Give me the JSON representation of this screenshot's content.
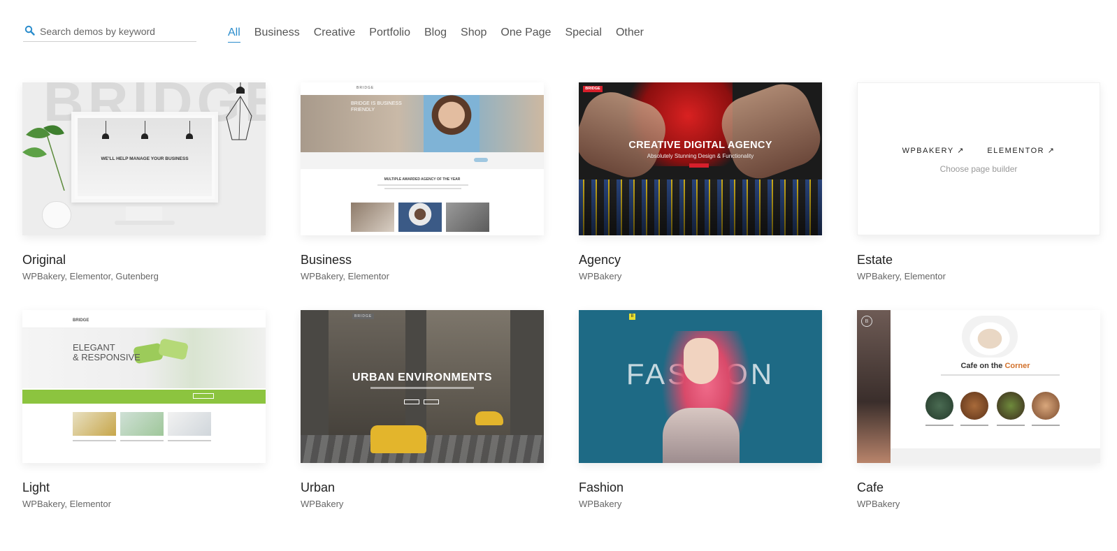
{
  "search": {
    "placeholder": "Search demos by keyword",
    "value": "",
    "icon": "search-icon"
  },
  "filters": [
    {
      "label": "All",
      "active": true
    },
    {
      "label": "Business",
      "active": false
    },
    {
      "label": "Creative",
      "active": false
    },
    {
      "label": "Portfolio",
      "active": false
    },
    {
      "label": "Blog",
      "active": false
    },
    {
      "label": "Shop",
      "active": false
    },
    {
      "label": "One Page",
      "active": false
    },
    {
      "label": "Special",
      "active": false
    },
    {
      "label": "Other",
      "active": false
    }
  ],
  "accent_color": "#2a8ccc",
  "demos": [
    {
      "title": "Original",
      "builders": "WPBakery,  Elementor,  Gutenberg",
      "preview": {
        "bg_word": "BRIDGE",
        "screen_text": "WE'LL HELP MANAGE YOUR BUSINESS"
      }
    },
    {
      "title": "Business",
      "builders": "WPBakery,  Elementor",
      "preview": {
        "logo": "BRIDGE",
        "hero_text": "BRIDGE IS BUSINESS FRIENDLY",
        "section_title": "MULTIPLE AWARDED AGENCY OF THE YEAR"
      }
    },
    {
      "title": "Agency",
      "builders": "WPBakery",
      "preview": {
        "badge": "BRIDGE",
        "headline": "CREATIVE DIGITAL AGENCY",
        "subline": "Absolutely Stunning Design & Functionality"
      }
    },
    {
      "title": "Estate",
      "builders": "WPBakery,  Elementor",
      "preview": {
        "link_wpbakery": "WPBAKERY ↗",
        "link_elementor": "ELEMENTOR ↗",
        "hint": "Choose page builder"
      }
    },
    {
      "title": "Light",
      "builders": "WPBakery,  Elementor",
      "preview": {
        "logo": "BRIDGE",
        "headline_1": "ELEGANT",
        "headline_2": "& RESPONSIVE"
      }
    },
    {
      "title": "Urban",
      "builders": "WPBakery",
      "preview": {
        "logo": "BRIDGE",
        "headline": "URBAN ENVIRONMENTS"
      }
    },
    {
      "title": "Fashion",
      "builders": "WPBakery",
      "preview": {
        "logo": "B",
        "headline": "FASHION"
      }
    },
    {
      "title": "Cafe",
      "builders": "WPBakery",
      "preview": {
        "logo": "B",
        "headline_1": "Cafe on the ",
        "headline_2": "Corner"
      }
    }
  ]
}
